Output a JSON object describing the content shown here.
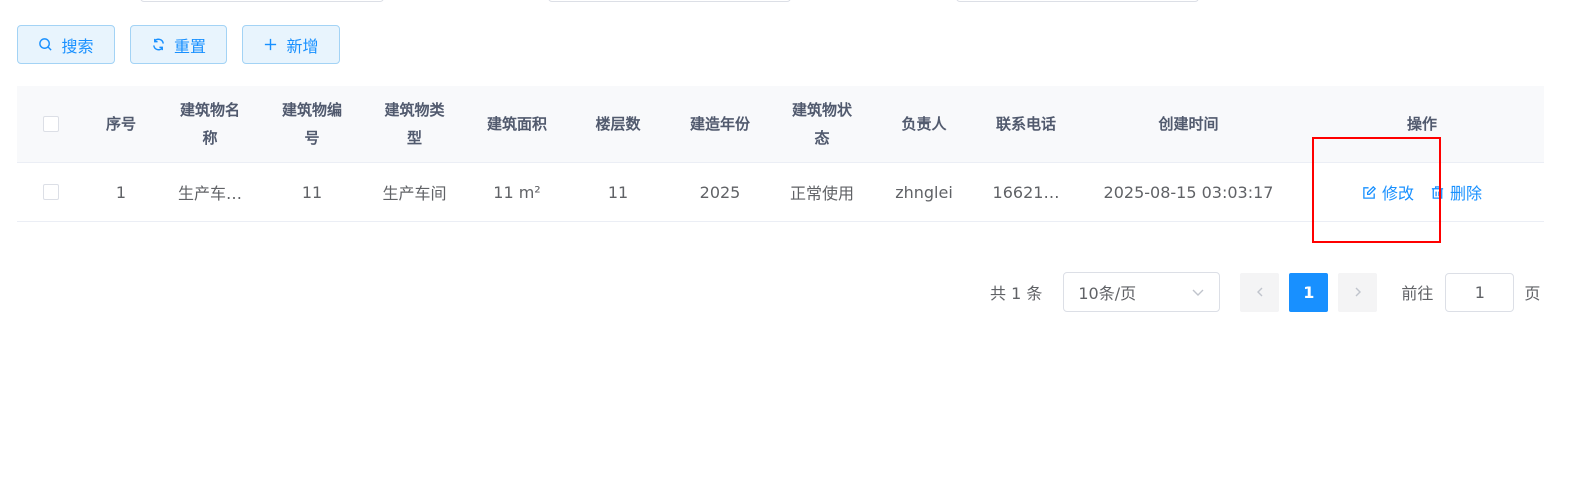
{
  "toolbar": {
    "search_label": "搜索",
    "reset_label": "重置",
    "add_label": "新增"
  },
  "table": {
    "headers": [
      "序号",
      "建筑物名称",
      "建筑物编号",
      "建筑物类型",
      "建筑面积",
      "楼层数",
      "建造年份",
      "建筑物状态",
      "负责人",
      "联系电话",
      "创建时间",
      "操作"
    ],
    "rows": [
      {
        "index": "1",
        "name": "生产车…",
        "code": "11",
        "type": "生产车间",
        "area": "11 m²",
        "floors": "11",
        "year": "2025",
        "status": "正常使用",
        "owner": "zhnglei",
        "phone": "16621…",
        "created": "2025-08-15 03:03:17",
        "edit_label": "修改",
        "delete_label": "删除"
      }
    ]
  },
  "pagination": {
    "total_text": "共 1 条",
    "page_size": "10条/页",
    "current_page": "1",
    "goto_label": "前往",
    "goto_value": "1",
    "page_unit": "页"
  },
  "colors": {
    "accent": "#1890ff",
    "highlight": "#ff0000"
  }
}
